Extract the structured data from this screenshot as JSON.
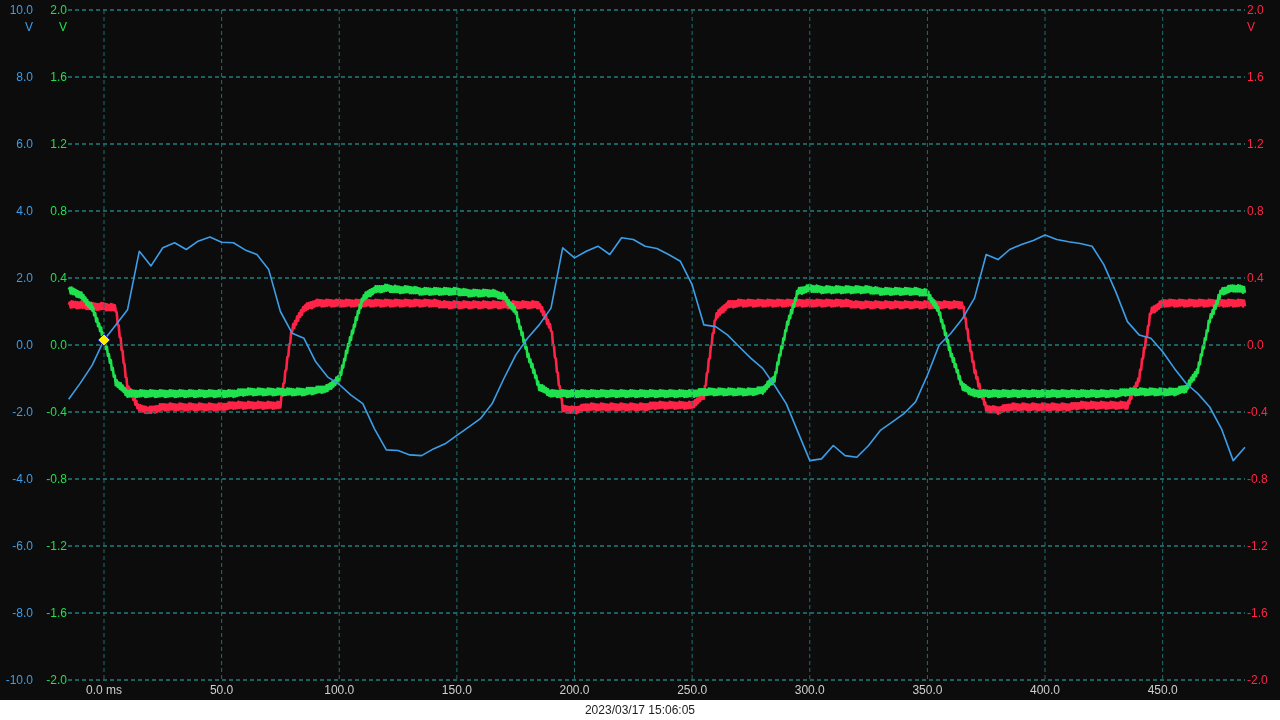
{
  "scope": {
    "left_channels": [
      {
        "kind": "smooth",
        "trigger_marker": true,
        "chart_data": {
          "type": "line",
          "ylabel": "V",
          "grid": true,
          "x": [
            -15,
            -10,
            -5,
            0,
            5,
            10,
            15,
            20,
            25,
            30,
            35,
            40,
            45,
            50,
            55,
            60,
            65,
            70,
            75,
            80,
            85,
            90,
            95,
            100,
            105,
            110,
            115,
            120,
            125,
            130,
            135,
            140,
            145,
            150,
            155,
            160,
            165,
            170,
            175,
            180,
            185,
            190,
            195,
            200,
            205,
            210,
            215,
            220,
            225,
            230,
            235,
            240,
            245,
            250,
            255,
            260,
            265,
            270,
            275,
            280,
            285,
            290,
            295,
            300,
            305,
            310,
            315,
            320,
            325,
            330,
            335,
            340,
            345,
            350,
            355,
            360,
            365,
            370,
            375,
            380,
            385,
            390,
            395,
            400,
            405,
            410,
            415,
            420,
            425,
            430,
            435,
            440,
            445,
            450,
            455,
            460,
            465,
            470,
            475,
            480,
            485
          ],
          "xlim": [
            -15.3,
            485
          ],
          "ylim": [
            -10,
            10
          ],
          "xticks": [
            {
              "value": 0,
              "label": "0.0 ms"
            },
            {
              "value": 50,
              "label": "50.0"
            },
            {
              "value": 100,
              "label": "100.0"
            },
            {
              "value": 150,
              "label": "150.0"
            },
            {
              "value": 200,
              "label": "200.0"
            },
            {
              "value": 250,
              "label": "250.0"
            },
            {
              "value": 300,
              "label": "300.0"
            },
            {
              "value": 350,
              "label": "350.0"
            },
            {
              "value": 400,
              "label": "400.0"
            },
            {
              "value": 450,
              "label": "450.0"
            }
          ],
          "yticks": [
            {
              "value": 10,
              "label": "10.0"
            },
            {
              "value": 8,
              "label": "8.0"
            },
            {
              "value": 6,
              "label": "6.0"
            },
            {
              "value": 4,
              "label": "4.0"
            },
            {
              "value": 2,
              "label": "2.0"
            },
            {
              "value": 0,
              "label": "0.0"
            },
            {
              "value": -2,
              "label": "-2.0"
            },
            {
              "value": -4,
              "label": "-4.0"
            },
            {
              "value": -6,
              "label": "-6.0"
            },
            {
              "value": -8,
              "label": "-8.0"
            },
            {
              "value": -10,
              "label": "-10.0"
            }
          ],
          "series": [
            {
              "color": "#3d9ee8",
              "values": [
                -1.62,
                -1.13,
                -0.6,
                0.15,
                0.6,
                1.05,
                2.8,
                2.36,
                2.9,
                3.05,
                2.85,
                3.1,
                3.22,
                3.07,
                3.05,
                2.84,
                2.7,
                2.25,
                1.0,
                0.35,
                0.2,
                -0.5,
                -0.95,
                -1.18,
                -1.5,
                -1.75,
                -2.5,
                -3.13,
                -3.15,
                -3.28,
                -3.3,
                -3.1,
                -2.95,
                -2.7,
                -2.45,
                -2.2,
                -1.75,
                -1.0,
                -0.3,
                0.2,
                0.6,
                1.1,
                2.9,
                2.6,
                2.8,
                2.95,
                2.7,
                3.2,
                3.15,
                2.95,
                2.88,
                2.7,
                2.5,
                1.8,
                0.6,
                0.55,
                0.3,
                -0.05,
                -0.4,
                -0.7,
                -1.2,
                -1.75,
                -2.6,
                -3.45,
                -3.4,
                -3.0,
                -3.3,
                -3.35,
                -3.0,
                -2.55,
                -2.3,
                -2.05,
                -1.7,
                -0.9,
                0.0,
                0.35,
                0.8,
                1.4,
                2.7,
                2.55,
                2.85,
                3.0,
                3.12,
                3.28,
                3.15,
                3.08,
                3.03,
                2.95,
                2.4,
                1.6,
                0.7,
                0.3,
                0.2,
                -0.2,
                -0.7,
                -1.15,
                -1.45,
                -1.85,
                -2.5,
                -3.45,
                -3.05
              ]
            }
          ]
        }
      },
      {
        "kind": "noisy",
        "chart_data": {
          "type": "line",
          "ylabel": "V",
          "grid": true,
          "x": [
            -15,
            -10,
            -5,
            0,
            5,
            10,
            15,
            20,
            25,
            30,
            35,
            40,
            45,
            50,
            55,
            60,
            65,
            70,
            75,
            80,
            85,
            90,
            95,
            100,
            105,
            110,
            115,
            120,
            125,
            130,
            135,
            140,
            145,
            150,
            155,
            160,
            165,
            170,
            175,
            180,
            185,
            190,
            195,
            200,
            205,
            210,
            215,
            220,
            225,
            230,
            235,
            240,
            245,
            250,
            255,
            260,
            265,
            270,
            275,
            280,
            285,
            290,
            295,
            300,
            305,
            310,
            315,
            320,
            325,
            330,
            335,
            340,
            345,
            350,
            355,
            360,
            365,
            370,
            375,
            380,
            385,
            390,
            395,
            400,
            405,
            410,
            415,
            420,
            425,
            430,
            435,
            440,
            445,
            450,
            455,
            460,
            465,
            470,
            475,
            480,
            485
          ],
          "xlim": [
            -15.3,
            485
          ],
          "ylim": [
            -2,
            2
          ],
          "yticks": [
            {
              "value": 2,
              "label": "2.0"
            },
            {
              "value": 1.6,
              "label": "1.6"
            },
            {
              "value": 1.2,
              "label": "1.2"
            },
            {
              "value": 0.8,
              "label": "0.8"
            },
            {
              "value": 0.4,
              "label": "0.4"
            },
            {
              "value": 0,
              "label": "0.0"
            },
            {
              "value": -0.4,
              "label": "-0.4"
            },
            {
              "value": -0.8,
              "label": "-0.8"
            },
            {
              "value": -1.2,
              "label": "-1.2"
            },
            {
              "value": -1.6,
              "label": "-1.6"
            },
            {
              "value": -2,
              "label": "-2.0"
            }
          ],
          "series": [
            {
              "color": "#1fe24e",
              "values": [
                0.33,
                0.3,
                0.22,
                0.04,
                -0.22,
                -0.29,
                -0.29,
                -0.29,
                -0.29,
                -0.29,
                -0.29,
                -0.29,
                -0.29,
                -0.29,
                -0.29,
                -0.28,
                -0.28,
                -0.28,
                -0.28,
                -0.28,
                -0.28,
                -0.27,
                -0.26,
                -0.2,
                0.05,
                0.28,
                0.33,
                0.34,
                0.33,
                0.33,
                0.32,
                0.32,
                0.32,
                0.32,
                0.31,
                0.31,
                0.31,
                0.29,
                0.2,
                -0.05,
                -0.25,
                -0.29,
                -0.29,
                -0.29,
                -0.29,
                -0.29,
                -0.29,
                -0.29,
                -0.29,
                -0.29,
                -0.29,
                -0.29,
                -0.29,
                -0.29,
                -0.28,
                -0.28,
                -0.28,
                -0.28,
                -0.28,
                -0.27,
                -0.2,
                0.1,
                0.32,
                0.34,
                0.33,
                0.33,
                0.33,
                0.33,
                0.33,
                0.32,
                0.32,
                0.32,
                0.32,
                0.31,
                0.2,
                -0.05,
                -0.25,
                -0.29,
                -0.29,
                -0.29,
                -0.29,
                -0.29,
                -0.29,
                -0.29,
                -0.29,
                -0.29,
                -0.29,
                -0.29,
                -0.29,
                -0.29,
                -0.28,
                -0.28,
                -0.28,
                -0.28,
                -0.28,
                -0.26,
                -0.15,
                0.15,
                0.32,
                0.34,
                0.33
              ]
            }
          ]
        }
      }
    ],
    "right_channels": [
      {
        "kind": "noisy",
        "chart_data": {
          "type": "line",
          "ylabel": "V",
          "grid": true,
          "x": [
            -15,
            -10,
            -5,
            0,
            5,
            10,
            15,
            20,
            25,
            30,
            35,
            40,
            45,
            50,
            55,
            60,
            65,
            70,
            75,
            80,
            85,
            90,
            95,
            100,
            105,
            110,
            115,
            120,
            125,
            130,
            135,
            140,
            145,
            150,
            155,
            160,
            165,
            170,
            175,
            180,
            185,
            190,
            195,
            200,
            205,
            210,
            215,
            220,
            225,
            230,
            235,
            240,
            245,
            250,
            255,
            260,
            265,
            270,
            275,
            280,
            285,
            290,
            295,
            300,
            305,
            310,
            315,
            320,
            325,
            330,
            335,
            340,
            345,
            350,
            355,
            360,
            365,
            370,
            375,
            380,
            385,
            390,
            395,
            400,
            405,
            410,
            415,
            420,
            425,
            430,
            435,
            440,
            445,
            450,
            455,
            460,
            465,
            470,
            475,
            480,
            485
          ],
          "xlim": [
            -15.3,
            485
          ],
          "ylim": [
            -2,
            2
          ],
          "yticks": [
            {
              "value": 2,
              "label": "2.0"
            },
            {
              "value": 1.6,
              "label": "1.6"
            },
            {
              "value": 1.2,
              "label": "1.2"
            },
            {
              "value": 0.8,
              "label": "0.8"
            },
            {
              "value": 0.4,
              "label": "0.4"
            },
            {
              "value": 0,
              "label": "0.0"
            },
            {
              "value": -0.4,
              "label": "-0.4"
            },
            {
              "value": -0.8,
              "label": "-0.8"
            },
            {
              "value": -1.2,
              "label": "-1.2"
            },
            {
              "value": -1.6,
              "label": "-1.6"
            },
            {
              "value": -2,
              "label": "-2.0"
            }
          ],
          "series": [
            {
              "color": "#ff2447",
              "values": [
                0.24,
                0.24,
                0.23,
                0.23,
                0.22,
                -0.25,
                -0.38,
                -0.39,
                -0.37,
                -0.37,
                -0.37,
                -0.37,
                -0.37,
                -0.37,
                -0.36,
                -0.36,
                -0.36,
                -0.36,
                -0.36,
                0.1,
                0.22,
                0.25,
                0.25,
                0.25,
                0.25,
                0.25,
                0.25,
                0.25,
                0.25,
                0.25,
                0.25,
                0.25,
                0.24,
                0.24,
                0.24,
                0.24,
                0.24,
                0.24,
                0.24,
                0.24,
                0.24,
                0.1,
                -0.38,
                -0.39,
                -0.37,
                -0.37,
                -0.37,
                -0.37,
                -0.37,
                -0.37,
                -0.36,
                -0.36,
                -0.36,
                -0.36,
                -0.3,
                0.17,
                0.24,
                0.25,
                0.25,
                0.25,
                0.25,
                0.25,
                0.25,
                0.25,
                0.25,
                0.25,
                0.25,
                0.24,
                0.24,
                0.24,
                0.24,
                0.24,
                0.24,
                0.24,
                0.24,
                0.24,
                0.24,
                -0.15,
                -0.38,
                -0.39,
                -0.37,
                -0.37,
                -0.37,
                -0.37,
                -0.37,
                -0.37,
                -0.36,
                -0.36,
                -0.36,
                -0.36,
                -0.36,
                -0.2,
                0.2,
                0.25,
                0.25,
                0.25,
                0.25,
                0.25,
                0.25,
                0.25,
                0.25
              ]
            }
          ]
        }
      }
    ],
    "timestamp": "2023/03/17 15:06:05"
  }
}
